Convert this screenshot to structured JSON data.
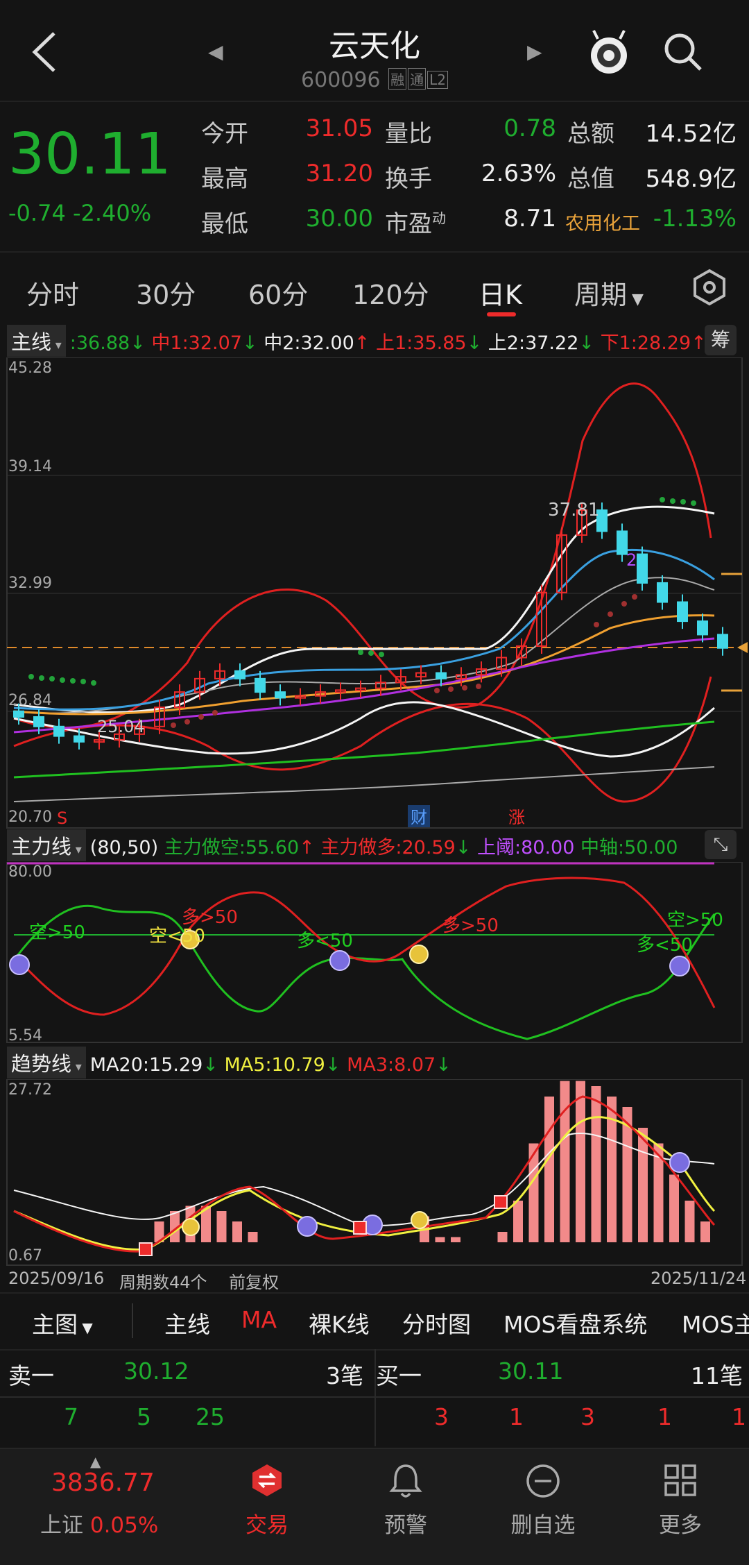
{
  "header": {
    "title": "云天化",
    "code": "600096",
    "tag1": "融",
    "tag2": "通",
    "tag3": "L2"
  },
  "quote": {
    "price": "30.11",
    "change": "-0.74",
    "change_pct": "-2.40%",
    "rows": [
      {
        "l1": "今开",
        "v1": "31.05",
        "l2": "量比",
        "v2": "0.78",
        "l3": "总额",
        "v3": "14.52亿"
      },
      {
        "l1": "最高",
        "v1": "31.20",
        "l2": "换手",
        "v2": "2.63%",
        "l3": "总值",
        "v3": "548.9亿"
      },
      {
        "l1": "最低",
        "v1": "30.00",
        "l2": "市盈",
        "l2sup": "动",
        "v2": "8.71",
        "l3": "农用化工",
        "v3": "-1.13%"
      }
    ]
  },
  "tabs": [
    "分时",
    "30分",
    "60分",
    "120分",
    "日K",
    "周期"
  ],
  "main_indicator": {
    "label": "主线",
    "v0": ":36.88",
    "zhong1": "中1:32.07",
    "zhong2": "中2:32.00",
    "shang1": "上1:35.85",
    "shang2": "上2:37.22",
    "xia1": "下1:28.29",
    "chip": "筹"
  },
  "main_axis": [
    "45.28",
    "39.14",
    "32.99",
    "26.84",
    "20.70"
  ],
  "main_annotations": {
    "high": "37.81",
    "low": "25.04",
    "s": "S",
    "cai": "财",
    "zhang": "涨",
    "two": "2"
  },
  "zl_indicator": {
    "label": "主力线",
    "params": "(80,50)",
    "kong": "主力做空:55.60",
    "duo": "主力做多:20.59",
    "yu": "上阈:80.00",
    "axis": "中轴:50.00"
  },
  "zl_axis": [
    "80.00",
    "5.54"
  ],
  "zl_notes": {
    "k1": "空>50",
    "k2": "空<50",
    "d1": "多>50",
    "d2": "多<50",
    "d3": "多>50",
    "d4": "多<50",
    "k3": "空>50"
  },
  "trend_indicator": {
    "label": "趋势线",
    "ma20": "MA20:15.29",
    "ma5": "MA5:10.79",
    "ma3": "MA3:8.07"
  },
  "trend_axis": [
    "27.72",
    "0.67"
  ],
  "footer_row": {
    "start": "2025/09/16",
    "periods": "周期数44个",
    "adj": "前复权",
    "end": "2025/11/24"
  },
  "subtabs": [
    "主图",
    "主线",
    "MA",
    "裸K线",
    "分时图",
    "MOS看盘系统",
    "MOS主"
  ],
  "orderbook": {
    "sell_label": "卖一",
    "sell_price": "30.12",
    "sell_count": "3笔",
    "buy_label": "买一",
    "buy_price": "30.11",
    "buy_count": "11笔",
    "sell_detail": [
      "7",
      "5",
      "25"
    ],
    "buy_detail": [
      "3",
      "1",
      "3",
      "1",
      "1"
    ]
  },
  "nav": {
    "index_value": "3836.77",
    "index_name": "上证",
    "index_pct": "0.05%",
    "items": [
      "交易",
      "预警",
      "删自选",
      "更多"
    ]
  },
  "colors": {
    "up": "#ee2b2b",
    "down": "#1fae2f",
    "bg": "#141414"
  },
  "chart_data": {
    "type": "line",
    "title": "",
    "ylim": [
      20.7,
      45.28
    ],
    "x_range": [
      "2025/09/16",
      "2025/11/24"
    ],
    "series": [
      {
        "name": "",
        "values": [
          26.5,
          26.0,
          25.5,
          25.2,
          25.3,
          25.6,
          26.0,
          27.0,
          27.8,
          28.5,
          28.9,
          28.5,
          27.8,
          27.5,
          27.6,
          27.8,
          27.9,
          28.0,
          28.3,
          28.6,
          28.8,
          28.5,
          28.7,
          29.0,
          29.6,
          30.2,
          33.0,
          36.0,
          37.3,
          36.2,
          35.0,
          33.5,
          32.5,
          31.5,
          30.8,
          30.1
        ]
      }
    ]
  }
}
